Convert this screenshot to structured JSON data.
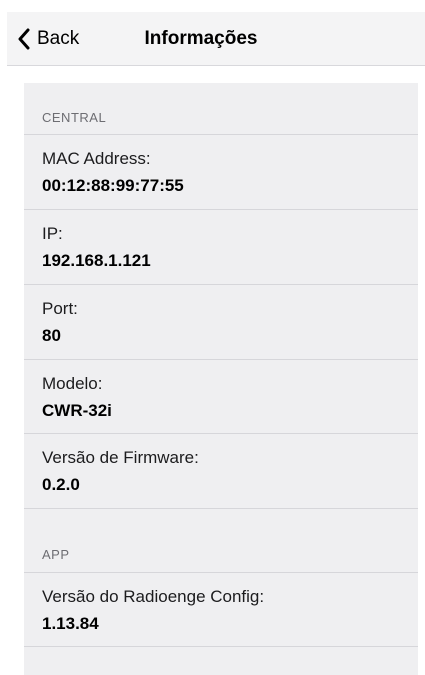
{
  "navbar": {
    "back_label": "Back",
    "title": "Informações"
  },
  "sections": {
    "central": {
      "header": "CENTRAL",
      "rows": [
        {
          "label": "MAC Address:",
          "value": "00:12:88:99:77:55"
        },
        {
          "label": "IP:",
          "value": "192.168.1.121"
        },
        {
          "label": "Port:",
          "value": "80"
        },
        {
          "label": "Modelo:",
          "value": "CWR-32i"
        },
        {
          "label": "Versão de Firmware:",
          "value": "0.2.0"
        }
      ]
    },
    "app": {
      "header": "APP",
      "rows": [
        {
          "label": "Versão do Radioenge Config:",
          "value": "1.13.84"
        }
      ]
    }
  },
  "icons": {
    "back": "chevron-left-icon"
  },
  "colors": {
    "background": "#ffffff",
    "navbar": "#f4f4f5",
    "grouped_background": "#efeff1",
    "separator": "#d6d6da",
    "section_header": "#6d6d72"
  }
}
